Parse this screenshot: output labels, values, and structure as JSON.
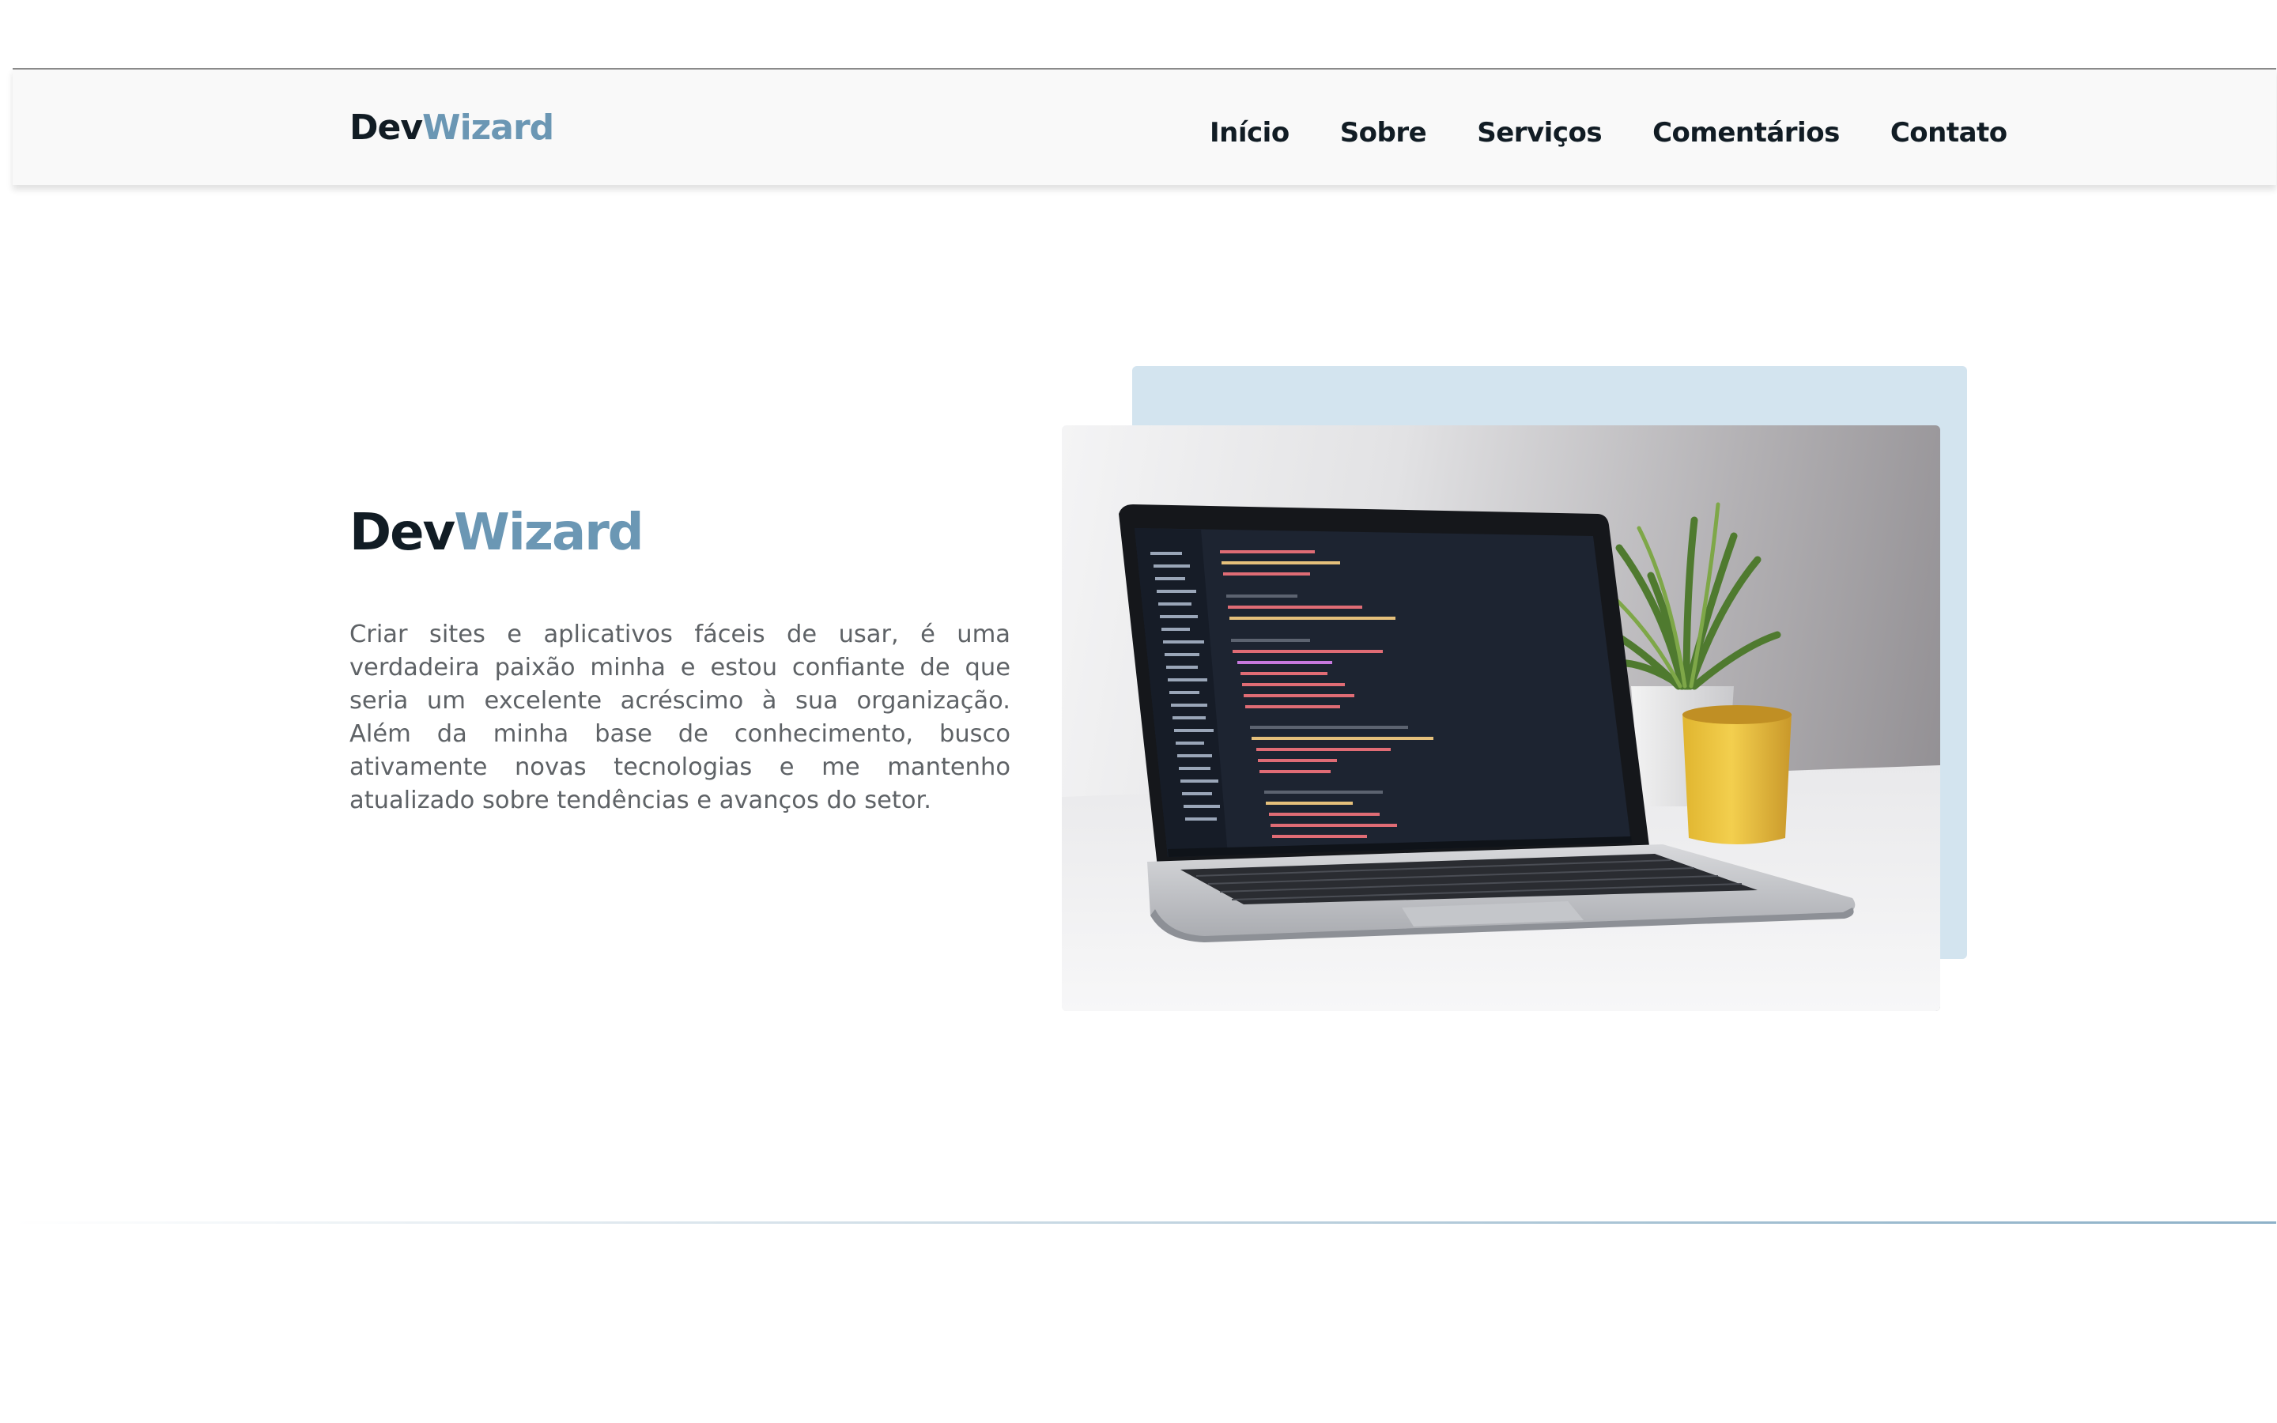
{
  "header": {
    "logo": {
      "part1": "Dev",
      "part2": "Wizard"
    },
    "nav": [
      "Início",
      "Sobre",
      "Serviços",
      "Comentários",
      "Contato"
    ]
  },
  "hero": {
    "title": {
      "part1": "Dev",
      "part2": "Wizard"
    },
    "description": "Criar sites e aplicativos fáceis de usar, é uma verdadeira paixão minha e estou confiante de que seria um excelente acréscimo à sua organização. Além da minha base de conhecimento, busco ativamente novas tecnologias e me mantenho atualizado sobre tendências e avanços do setor."
  },
  "colors": {
    "accent": "#6b97b4",
    "text_dark": "#111c24",
    "body_text": "#5e6266",
    "image_backdrop": "#d3e4ef",
    "header_bg": "#f9f9f9"
  },
  "images": {
    "hero": "laptop-with-code-editor-and-plant-photo"
  }
}
